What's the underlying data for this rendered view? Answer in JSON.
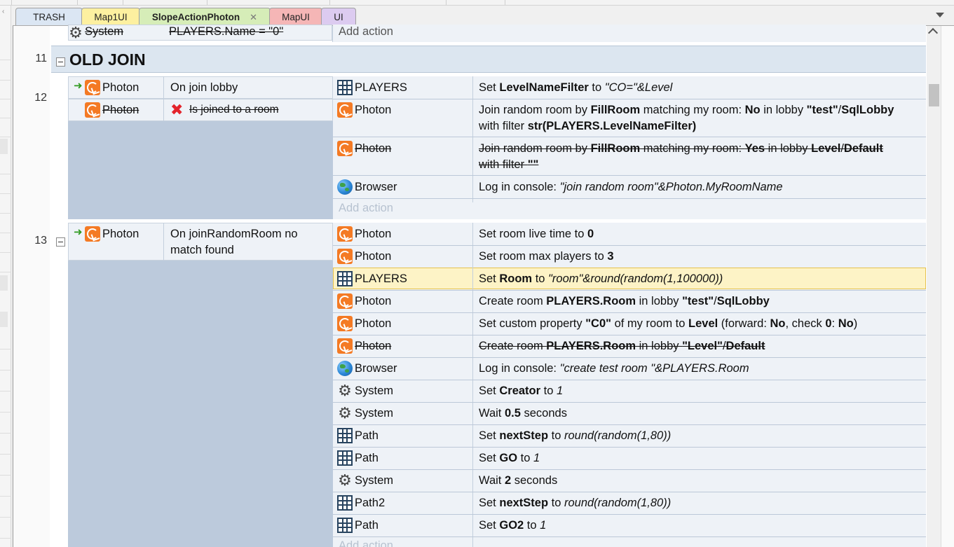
{
  "tabs": [
    {
      "label": "TRASH",
      "color": "#dbe6f3"
    },
    {
      "label": "Map1UI",
      "color": "#fdf0a0"
    },
    {
      "label": "SlopeActionPhoton",
      "color": "#d6edb8",
      "close": "✕"
    },
    {
      "label": "MapUI",
      "color": "#f5b6b6"
    },
    {
      "label": "UI",
      "color": "#dccbf0"
    }
  ],
  "colors": {
    "highlight": "#fdf3c6",
    "event_bg": "#bccadc",
    "header_bg": "#dce6f0"
  },
  "top_row": {
    "object": "System",
    "condition": "PLAYERS.Name = \"0\"",
    "add_action": "Add action"
  },
  "group": {
    "row_number": "11",
    "title": "OLD JOIN"
  },
  "event12": {
    "row_number": "12",
    "conditions": [
      {
        "icon": "photon-icon",
        "object": "Photon",
        "text": "On join lobby"
      },
      {
        "icon": "photon-icon",
        "object": "Photon",
        "text": "Is joined to a room",
        "disabled": true
      }
    ],
    "actions": [
      {
        "icon": "grid-icon",
        "object": "PLAYERS",
        "pre": "Set ",
        "b1": "LevelNameFilter",
        "mid": " to ",
        "i1": "\"CO=\"&Level"
      },
      {
        "icon": "photon-icon",
        "object": "Photon",
        "t1": "Join random room by ",
        "b1": "FillRoom",
        "t2": " matching my room: ",
        "b2": "No",
        "t3": " in lobby ",
        "b3": "\"test\"",
        "t4": "/",
        "b4": "SqlLobby",
        "t5": "with filter ",
        "b5": "str(PLAYERS.LevelNameFilter)"
      },
      {
        "icon": "photon-icon",
        "object": "Photon",
        "disabled": true,
        "t1": "Join random room by ",
        "b1": "FillRoom",
        "t2": " matching my room: ",
        "b2": "Yes",
        "t3": " in lobby ",
        "b3": "Level",
        "t4": "/",
        "b4": "Default",
        "t5": "with filter ",
        "b5": "\"\""
      },
      {
        "icon": "globe-icon",
        "object": "Browser",
        "t1": "Log in console: ",
        "i1": "\"join random room\"&Photon.MyRoomName"
      }
    ],
    "add_action": "Add action"
  },
  "event13": {
    "row_number": "13",
    "condition": {
      "icon": "photon-icon",
      "object": "Photon",
      "line1": "On joinRandomRoom no",
      "line2": "match found"
    },
    "actions": [
      {
        "icon": "photon-icon",
        "object": "Photon",
        "t1": "Set room live time to ",
        "b1": "0"
      },
      {
        "icon": "photon-icon",
        "object": "Photon",
        "t1": "Set room max players to ",
        "b1": "3"
      },
      {
        "icon": "grid-icon",
        "object": "PLAYERS",
        "t1": "Set ",
        "b1": "Room",
        "t2": " to ",
        "i1": "\"room\"&round(random(1,100000))",
        "selected": true
      },
      {
        "icon": "photon-icon",
        "object": "Photon",
        "t1": "Create room ",
        "b1": "PLAYERS.Room",
        "t2": " in lobby ",
        "b2": "\"test\"",
        "t3": "/",
        "b3": "SqlLobby"
      },
      {
        "icon": "photon-icon",
        "object": "Photon",
        "t1": "Set custom property ",
        "b1": "\"C0\"",
        "t2": " of my room to ",
        "b2": "Level",
        "t3": " (forward: ",
        "b3": "No",
        "t4": ", check ",
        "b4": "0",
        "t5": ": ",
        "b5": "No",
        "t6": ")"
      },
      {
        "icon": "photon-icon",
        "object": "Photon",
        "disabled": true,
        "t1": "Create room ",
        "b1": "PLAYERS.Room",
        "t2": " in lobby ",
        "b2": "\"Level\"",
        "t3": "/",
        "b3": "Default"
      },
      {
        "icon": "globe-icon",
        "object": "Browser",
        "t1": "Log in console: ",
        "i1": "\"create test room  \"&PLAYERS.Room"
      },
      {
        "icon": "gear-icon",
        "object": "System",
        "t1": "Set ",
        "b1": "Creator",
        "t2": " to ",
        "i1": "1"
      },
      {
        "icon": "gear-icon",
        "object": "System",
        "t1": "Wait ",
        "b1": "0.5",
        "t2": " seconds"
      },
      {
        "icon": "grid-icon",
        "object": "Path",
        "t1": "Set ",
        "b1": "nextStep",
        "t2": " to ",
        "i1": "round(random(1,80))"
      },
      {
        "icon": "grid-icon",
        "object": "Path",
        "t1": "Set ",
        "b1": "GO",
        "t2": " to ",
        "i1": "1"
      },
      {
        "icon": "gear-icon",
        "object": "System",
        "t1": "Wait ",
        "b1": "2",
        "t2": " seconds"
      },
      {
        "icon": "grid-icon",
        "object": "Path2",
        "t1": "Set ",
        "b1": "nextStep",
        "t2": " to ",
        "i1": "round(random(1,80))"
      },
      {
        "icon": "grid-icon",
        "object": "Path",
        "t1": "Set ",
        "b1": "GO2",
        "t2": " to ",
        "i1": "1"
      }
    ],
    "add_action": "Add action"
  }
}
